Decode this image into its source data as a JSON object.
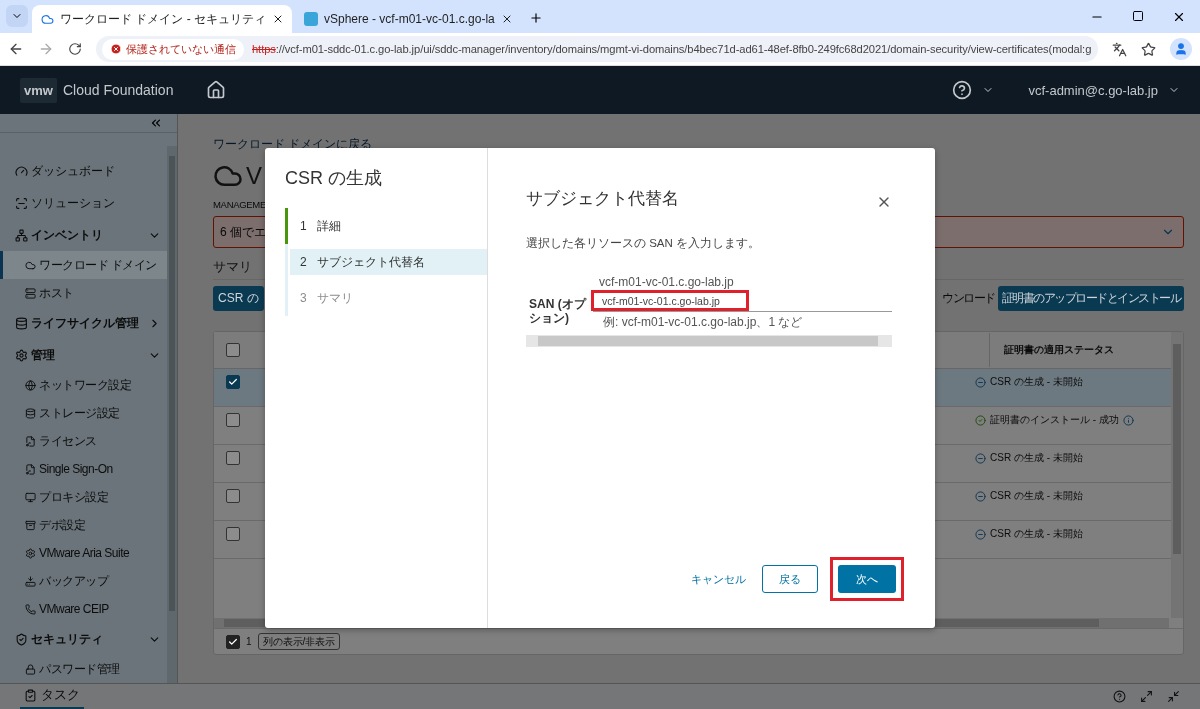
{
  "browser": {
    "tabs": [
      {
        "title": "ワークロード ドメイン - セキュリティ",
        "selected": true
      },
      {
        "title": "vSphere - vcf-m01-vc-01.c.go-la",
        "selected": false
      }
    ],
    "security_chip": "保護されていない通信",
    "url_scheme": "https",
    "url_rest": "://vcf-m01-sddc-01.c.go-lab.jp/ui/sddc-manager/inventory/domains/mgmt-vi-domains/b4bec71d-ad61-48ef-8fb0-249fc68d2021/domain-security/view-certificates(modal:g"
  },
  "app_header": {
    "logo": "vmw",
    "product": "Cloud Foundation",
    "user": "vcf-admin@c.go-lab.jp"
  },
  "sidebar": {
    "items": [
      {
        "kind": "link",
        "label": "ダッシュボード"
      },
      {
        "kind": "link",
        "label": "ソリューション"
      },
      {
        "kind": "section",
        "label": "インベントリ",
        "expanded": true,
        "children": [
          {
            "label": "ワークロード ドメイン",
            "selected": true
          },
          {
            "label": "ホスト",
            "selected": false
          }
        ]
      },
      {
        "kind": "section",
        "label": "ライフサイクル管理",
        "expanded": false
      },
      {
        "kind": "section",
        "label": "管理",
        "expanded": true,
        "children": [
          {
            "label": "ネットワーク設定",
            "selected": false
          },
          {
            "label": "ストレージ設定",
            "selected": false
          },
          {
            "label": "ライセンス",
            "selected": false
          },
          {
            "label": "Single Sign-On",
            "selected": false
          },
          {
            "label": "プロキシ設定",
            "selected": false
          },
          {
            "label": "デポ設定",
            "selected": false
          },
          {
            "label": "VMware Aria Suite",
            "selected": false
          },
          {
            "label": "バックアップ",
            "selected": false
          },
          {
            "label": "VMware CEIP",
            "selected": false
          }
        ]
      },
      {
        "kind": "section",
        "label": "セキュリティ",
        "expanded": true,
        "children": [
          {
            "label": "パスワード管理",
            "selected": false
          }
        ]
      }
    ]
  },
  "page": {
    "breadcrumb": "ワークロード ドメインに戻る",
    "title": "V",
    "subtitle": "MANAGEME",
    "alert": "6 個でエ",
    "summary_tab": "サマリ",
    "left_button": "CSR の",
    "download_link": "ウンロード",
    "upload_button": "証明書のアップロードとインストール",
    "table": {
      "header_checked": false,
      "status_column": "証明書の適用ステータス",
      "rows": [
        {
          "checked": true,
          "status": {
            "kind": "pending",
            "text": "CSR の生成 - 未開始",
            "info": false
          }
        },
        {
          "checked": false,
          "status": {
            "kind": "success",
            "text": "証明書のインストール - 成功",
            "info": true
          }
        },
        {
          "checked": false,
          "status": {
            "kind": "pending",
            "text": "CSR の生成 - 未開始",
            "info": false
          }
        },
        {
          "checked": false,
          "status": {
            "kind": "pending",
            "text": "CSR の生成 - 未開始",
            "info": false
          }
        },
        {
          "checked": false,
          "status": {
            "kind": "pending",
            "text": "CSR の生成 - 未開始",
            "info": false
          }
        }
      ],
      "footer_checked": true,
      "selected_count": "1",
      "columns_toggle": "列の表示/非表示"
    }
  },
  "taskbar": {
    "label": "タスク"
  },
  "modal": {
    "title": "CSR の生成",
    "steps": [
      {
        "number": "1",
        "label": "詳細",
        "completed": true,
        "selected": false,
        "disabled": false
      },
      {
        "number": "2",
        "label": "サブジェクト代替名",
        "completed": false,
        "selected": true,
        "disabled": false
      },
      {
        "number": "3",
        "label": "サマリ",
        "completed": false,
        "selected": false,
        "disabled": true
      }
    ],
    "heading": "サブジェクト代替名",
    "description": "選択した各リソースの SAN を入力します。",
    "resource_name": "vcf-m01-vc-01.c.go-lab.jp",
    "field": {
      "label": "SAN (オプション)",
      "value": "vcf-m01-vc-01.c.go-lab.jp",
      "hint": "例: vcf-m01-vc-01.c.go-lab.jp、1 など",
      "highlighted": true
    },
    "cancel": "キャンセル",
    "back": "戻る",
    "next": {
      "label": "次へ",
      "highlighted": true
    }
  }
}
